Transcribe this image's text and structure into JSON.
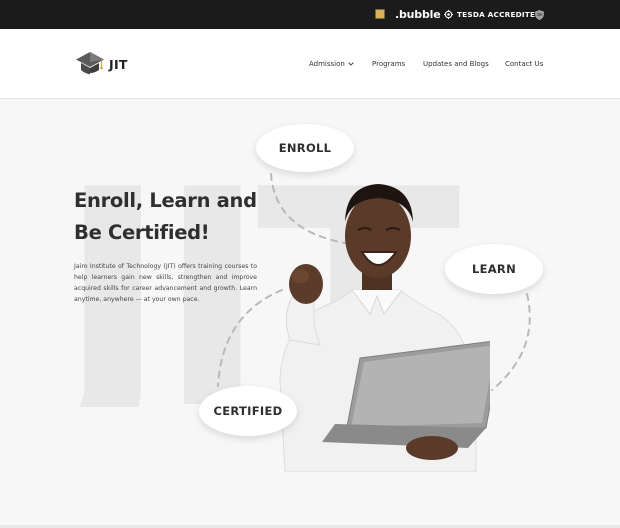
{
  "topbar": {
    "bubble_label": ".bubble",
    "tesda_label": "TESDA ACCREDITED"
  },
  "header": {
    "logo_text": "JIT",
    "nav": [
      {
        "label": "Admission",
        "has_dropdown": true
      },
      {
        "label": "Programs"
      },
      {
        "label": "Updates and Blogs"
      },
      {
        "label": "Contact Us"
      }
    ]
  },
  "hero": {
    "title_line1": "Enroll, Learn and",
    "title_line2": "Be Certified!",
    "description": "Jairo Institute of Technology (JIT) offers training courses to help learners gain new skills, strengthen and improve acquired skills for career advancement and growth. Learn anytime, anywhere — at your own pace.",
    "watermark_text": "JIT",
    "bubbles": {
      "enroll": "ENROLL",
      "learn": "LEARN",
      "certified": "CERTIFIED"
    }
  },
  "colors": {
    "topbar_bg": "#1b1b1b",
    "hero_bg": "#f7f7f7",
    "watermark": "#e8e8e8",
    "text_dark": "#2f2f2f"
  },
  "icons": [
    "badge-icon",
    "tesda-gear-icon",
    "shield-icon",
    "graduation-cap-logo-icon",
    "chevron-down-icon"
  ]
}
